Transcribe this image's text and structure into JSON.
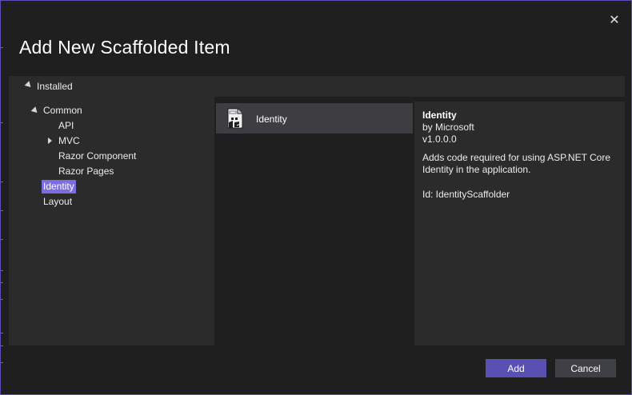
{
  "dialog": {
    "title": "Add New Scaffolded Item",
    "close_glyph": "✕"
  },
  "installed": {
    "label": "Installed"
  },
  "tree": {
    "common": "Common",
    "api": "API",
    "mvc": "MVC",
    "razor_component": "Razor Component",
    "razor_pages": "Razor Pages",
    "identity": "Identity",
    "layout": "Layout"
  },
  "list": {
    "items": [
      {
        "name": "Identity",
        "icon": "scaffold-file-icon"
      }
    ]
  },
  "details": {
    "name": "Identity",
    "author": "by Microsoft",
    "version": "v1.0.0.0",
    "description": "Adds code required for using ASP.NET Core Identity in the application.",
    "id": "Id: IdentityScaffolder"
  },
  "buttons": {
    "add": "Add",
    "cancel": "Cancel"
  },
  "colors": {
    "accent": "#5a4fb2",
    "selection": "#7a6de0",
    "panel": "#2b2b2b",
    "background": "#1f1f1f"
  }
}
